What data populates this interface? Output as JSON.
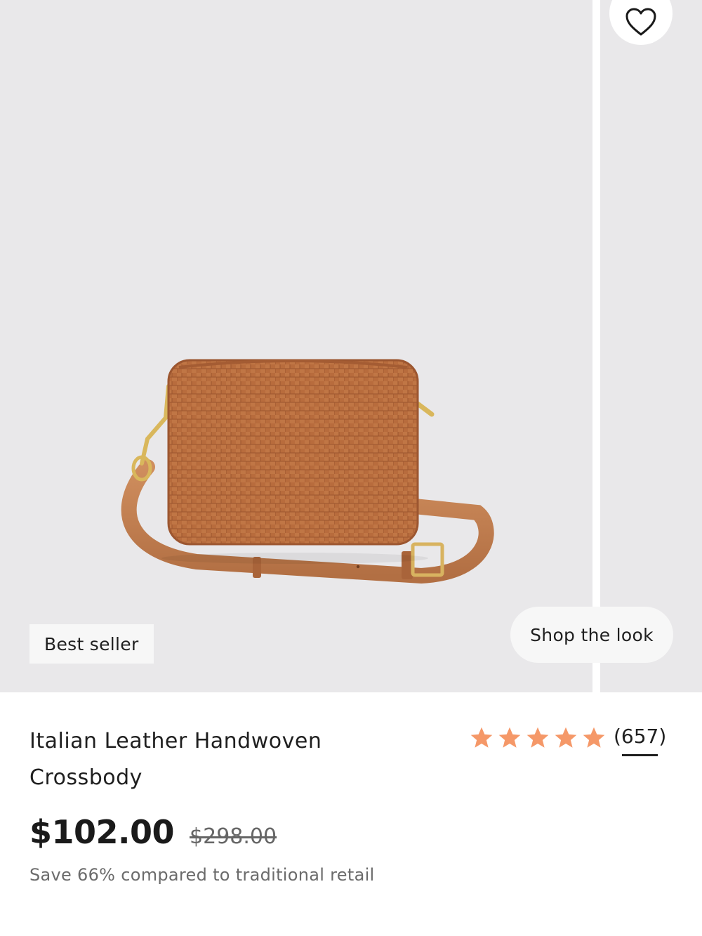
{
  "product": {
    "title": "Italian Leather Handwoven Crossbody",
    "badge": "Best seller",
    "shop_the_look_label": "Shop the look",
    "price": "$102.00",
    "original_price": "$298.00",
    "savings_text": "Save 66% compared to traditional retail",
    "rating": {
      "stars": 5,
      "review_count": "(657)"
    },
    "image_icon": "woven-crossbody-bag",
    "wishlist_icon": "heart-icon"
  },
  "colors": {
    "image_background": "#e9e8ea",
    "star": "#f59868",
    "leather": "#b46a3c",
    "text": "#1f1f1f",
    "muted_text": "#6b6b6b"
  }
}
